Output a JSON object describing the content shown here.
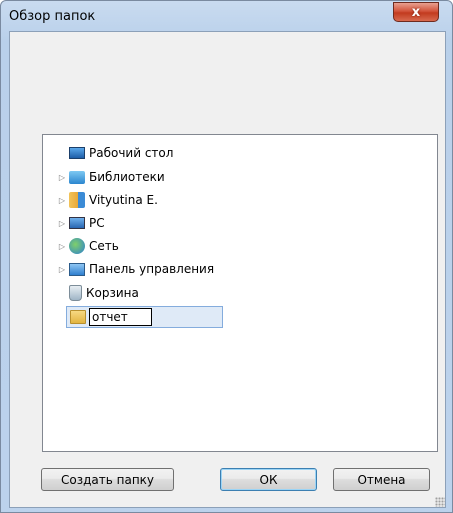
{
  "window": {
    "title": "Обзор папок",
    "close_label": "x"
  },
  "tree": {
    "items": [
      {
        "label": "Рабочий стол",
        "icon": "desktop-icon",
        "expandable": false
      },
      {
        "label": "Библиотеки",
        "icon": "libraries-icon",
        "expandable": true
      },
      {
        "label": "Vityutina E.",
        "icon": "user-folder-icon",
        "expandable": true
      },
      {
        "label": "PC",
        "icon": "computer-icon",
        "expandable": true
      },
      {
        "label": "Сеть",
        "icon": "network-icon",
        "expandable": true
      },
      {
        "label": "Панель управления",
        "icon": "control-panel-icon",
        "expandable": true
      },
      {
        "label": "Корзина",
        "icon": "recycle-bin-icon",
        "expandable": false
      }
    ],
    "new_folder": {
      "icon": "folder-icon",
      "value": "отчет"
    }
  },
  "buttons": {
    "create_folder": "Создать папку",
    "ok": "ОК",
    "cancel": "Отмена"
  }
}
